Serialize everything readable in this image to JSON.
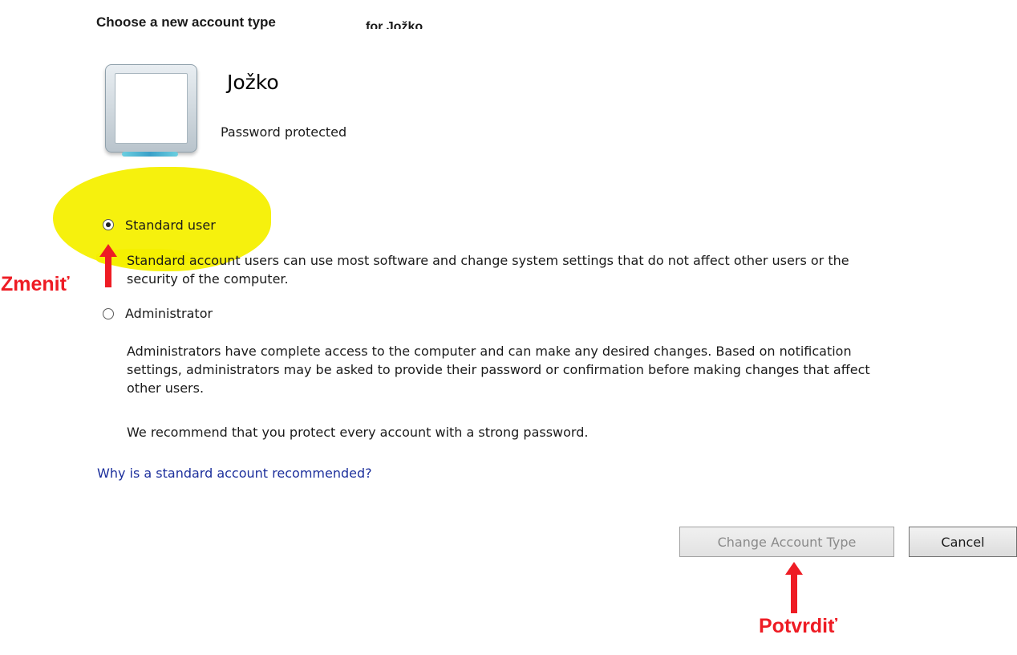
{
  "header": {
    "title": "Choose a new account type",
    "title_suffix": "for Jožko"
  },
  "account": {
    "name": "Jožko",
    "status": "Password protected"
  },
  "options": {
    "standard_label": "Standard user",
    "standard_desc_line1": "Standard account users can use most software and change system settings that do not affect other users or the",
    "standard_desc_line2": "security of the computer.",
    "admin_label": "Administrator",
    "admin_desc_line1": "Administrators have complete access to the computer and can make any desired changes. Based on notification",
    "admin_desc_line2": "settings, administrators may be asked to provide their password or confirmation before making changes that affect",
    "admin_desc_line3": "other users.",
    "selected": "Standard user"
  },
  "recommendation": "We recommend that you protect every account with a strong password.",
  "help_link": "Why is a standard account recommended?",
  "buttons": {
    "change": "Change Account Type",
    "cancel": "Cancel"
  },
  "annotations": {
    "change_hint": "Zmeniť",
    "confirm_hint": "Potvrdiť",
    "color": "#ee1c24",
    "highlight_color": "#f5f000"
  }
}
